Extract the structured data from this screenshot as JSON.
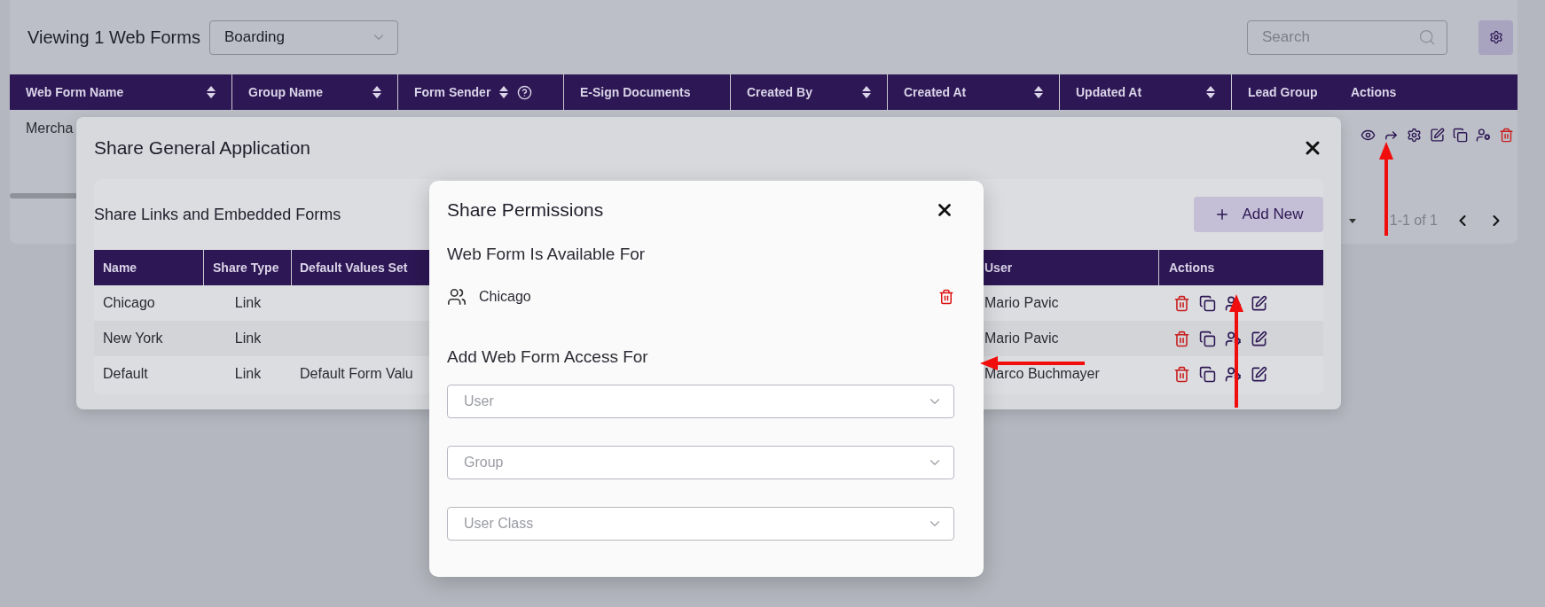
{
  "page": {
    "title": "Viewing 1 Web Forms",
    "form_filter": {
      "value": "Boarding"
    },
    "search": {
      "placeholder": "Search"
    }
  },
  "table": {
    "columns": [
      {
        "label": "Web Form Name",
        "sortable": true,
        "help": false
      },
      {
        "label": "Group Name",
        "sortable": true,
        "help": false
      },
      {
        "label": "Form Sender",
        "sortable": true,
        "help": true
      },
      {
        "label": "E-Sign Documents",
        "sortable": false,
        "help": false
      },
      {
        "label": "Created By",
        "sortable": true,
        "help": false
      },
      {
        "label": "Created At",
        "sortable": true,
        "help": false
      },
      {
        "label": "Updated At",
        "sortable": true,
        "help": false
      },
      {
        "label": "Lead Group",
        "sortable": false,
        "help": false
      },
      {
        "label": "Actions",
        "sortable": false,
        "help": false
      }
    ],
    "rows": [
      {
        "name": "Mercha",
        "actions": [
          {
            "kind": "view"
          },
          {
            "kind": "share"
          },
          {
            "kind": "settings"
          },
          {
            "kind": "edit"
          },
          {
            "kind": "copy"
          },
          {
            "kind": "permissions"
          },
          {
            "kind": "delete"
          }
        ]
      }
    ]
  },
  "pagination": {
    "range": "1-1 of 1"
  },
  "share_dialog": {
    "title": "Share General Application",
    "section_title": "Share Links and Embedded Forms",
    "add_button": "Add New",
    "columns": [
      "Name",
      "Share Type",
      "Default Values Set",
      "User",
      "Actions"
    ],
    "row_actions": [
      {
        "kind": "delete"
      },
      {
        "kind": "copy"
      },
      {
        "kind": "permissions"
      },
      {
        "kind": "edit"
      }
    ],
    "rows": [
      {
        "name": "Chicago",
        "share_type": "Link",
        "user": "Mario Pavic"
      },
      {
        "name": "New York",
        "share_type": "Link",
        "user": "Mario Pavic"
      },
      {
        "name": "Default",
        "share_type": "Link",
        "default_values": "Default Form Valu",
        "user": "Marco Buchmayer"
      }
    ]
  },
  "permissions_dialog": {
    "title": "Share Permissions",
    "available_heading": "Web Form Is Available For",
    "available": [
      {
        "kind": "group",
        "name": "Chicago"
      }
    ],
    "add_heading": "Add Web Form Access For",
    "selects": [
      {
        "placeholder": "User"
      },
      {
        "placeholder": "Group"
      },
      {
        "placeholder": "User Class"
      }
    ]
  },
  "annotations": [
    {
      "kind": "arrow-up"
    },
    {
      "kind": "arrow-up"
    },
    {
      "kind": "arrow-left"
    }
  ]
}
